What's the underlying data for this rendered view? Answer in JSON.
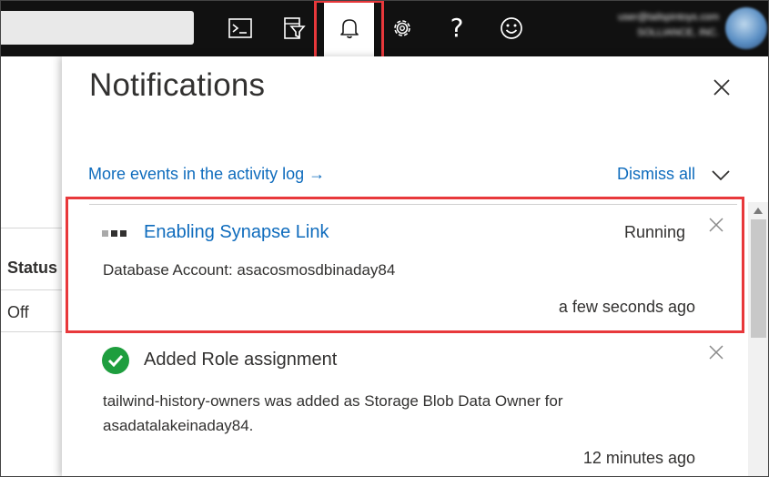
{
  "topbar": {
    "icons": [
      "cloud-shell-icon",
      "directory-filter-icon",
      "bell-icon",
      "gear-icon",
      "help-icon",
      "feedback-smiley-icon"
    ],
    "help_glyph": "?",
    "account": {
      "email_line": "user@tailspintoys.com",
      "org_line": "SOLLIANCE, INC."
    }
  },
  "background": {
    "status_header": "Status",
    "status_value": "Off"
  },
  "notifications": {
    "title": "Notifications",
    "activity_link": "More events in the activity log →",
    "dismiss_all": "Dismiss all",
    "items": [
      {
        "title": "Enabling Synapse Link",
        "status": "Running",
        "body": "Database Account: asacosmosdbinaday84",
        "time": "a few seconds ago",
        "icon": "progress-dots-icon"
      },
      {
        "title": "Added Role assignment",
        "body": "tailwind-history-owners was added as Storage Blob Data Owner for asadatalakeinaday84.",
        "time": "12 minutes ago",
        "icon": "success-check-icon"
      }
    ]
  },
  "colors": {
    "link": "#0f6cbd",
    "highlight": "#e8383b",
    "success": "#1e9e3e",
    "topbar": "#111111"
  }
}
